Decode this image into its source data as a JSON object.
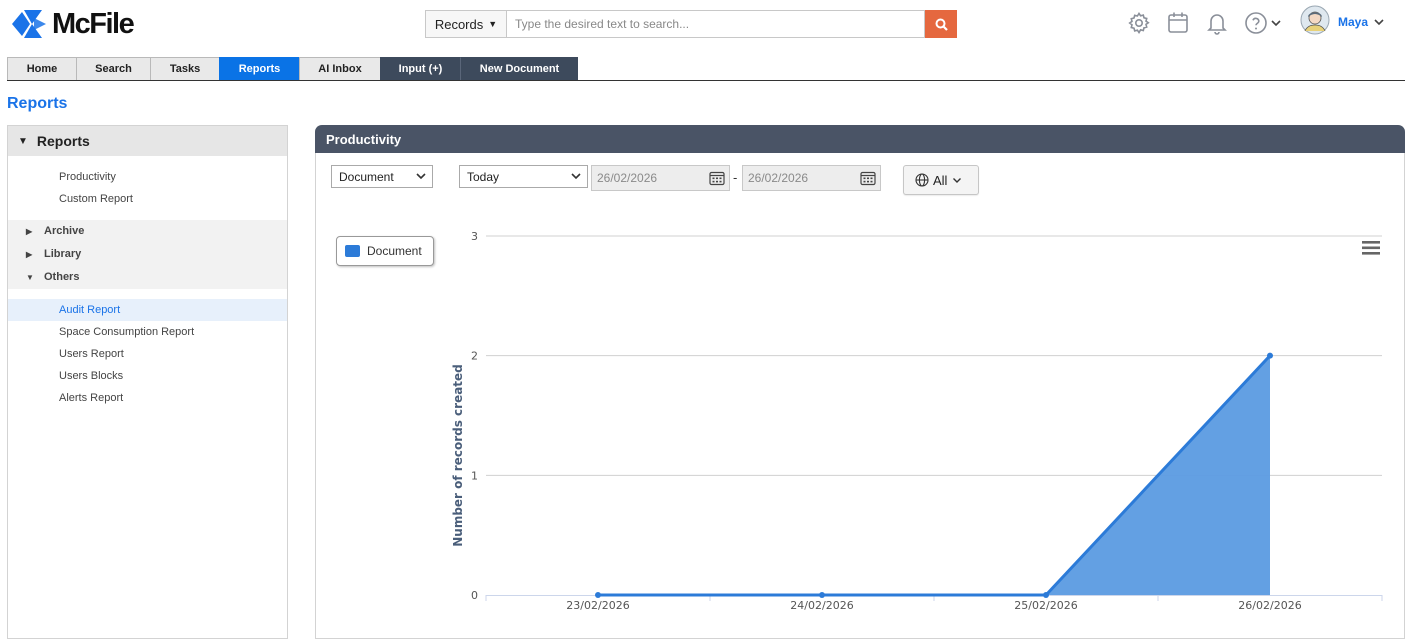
{
  "app": {
    "name": "McFile"
  },
  "search": {
    "scope": "Records",
    "placeholder": "Type the desired text to search..."
  },
  "user": {
    "name": "Maya"
  },
  "nav": {
    "tabs": [
      {
        "label": "Home",
        "active": false
      },
      {
        "label": "Search",
        "active": false
      },
      {
        "label": "Tasks",
        "active": false
      },
      {
        "label": "Reports",
        "active": true
      },
      {
        "label": "AI Inbox",
        "active": false
      },
      {
        "label": "Input (+)",
        "active": false
      },
      {
        "label": "New Document",
        "active": false
      }
    ]
  },
  "page": {
    "title": "Reports"
  },
  "sidebar": {
    "header": "Reports",
    "items": [
      "Productivity",
      "Custom Report"
    ],
    "groups": [
      "Archive",
      "Library",
      "Others"
    ],
    "others_items": [
      "Audit Report",
      "Space Consumption Report",
      "Users Report",
      "Users Blocks",
      "Alerts Report"
    ],
    "active_item": "Audit Report"
  },
  "panel": {
    "title": "Productivity",
    "filters": {
      "type": "Document",
      "period": "Today",
      "date_from": "26/02/2026",
      "date_to": "26/02/2026",
      "scope": "All"
    }
  },
  "colors": {
    "brand": "#1a73e8",
    "accent": "#e5683f",
    "series": "#2c7bd8",
    "series_fill": "#5b9be1"
  },
  "chart_data": {
    "type": "area",
    "categories": [
      "23/02/2026",
      "24/02/2026",
      "25/02/2026",
      "26/02/2026"
    ],
    "series": [
      {
        "name": "Document",
        "values": [
          0,
          0,
          0,
          2
        ]
      }
    ],
    "ylabel": "Number of records created",
    "xlabel": "",
    "ylim": [
      0,
      3
    ],
    "yticks": [
      0,
      1,
      2,
      3
    ],
    "grid": true,
    "legend": "top-left"
  }
}
